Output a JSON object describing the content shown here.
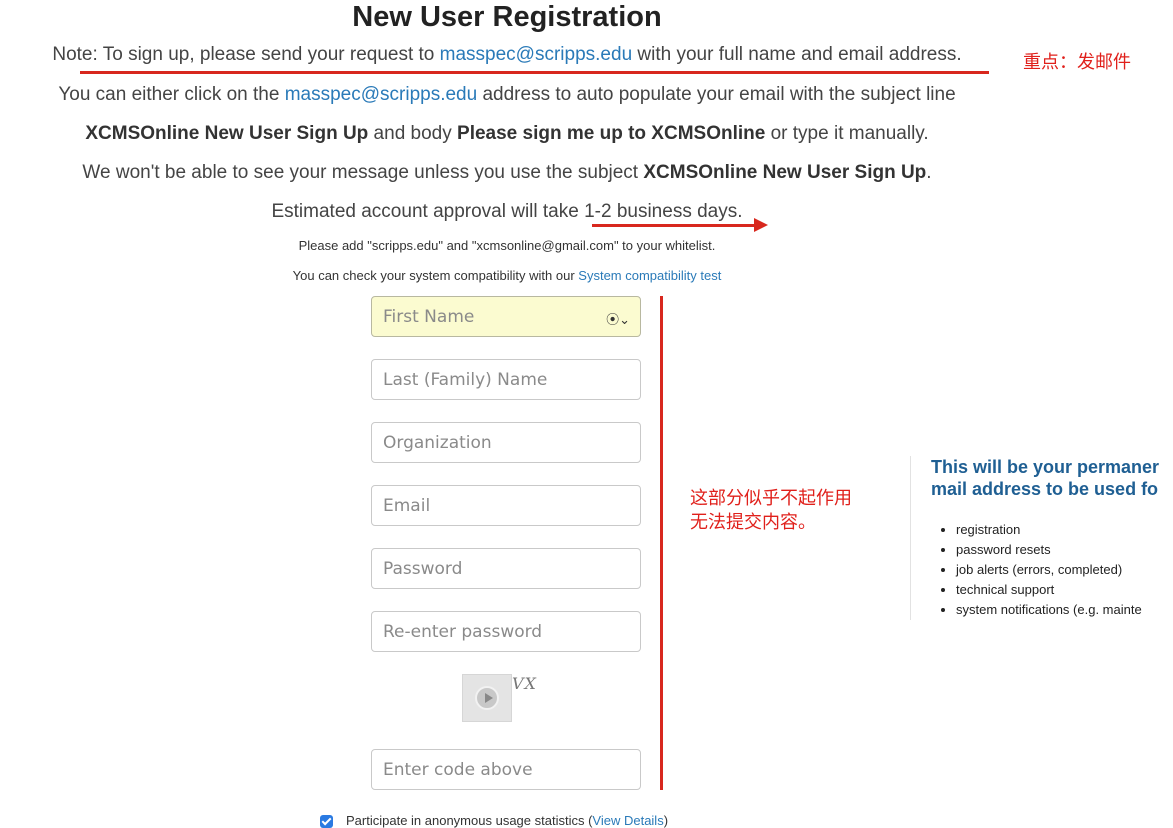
{
  "page": {
    "title": "New User Registration"
  },
  "note": {
    "prefix": "Note: ",
    "text1": "To sign up, please send your request to ",
    "email": "masspec@scripps.edu",
    "text2": " with your full name and email address."
  },
  "line2": {
    "text1": "You can either click on the ",
    "email": "masspec@scripps.edu",
    "text2": " address to auto populate your email with the subject line"
  },
  "line3": {
    "bold1": "XCMSOnline New User Sign Up",
    "text1": " and body ",
    "bold2": "Please sign me up to XCMSOnline",
    "text2": " or type it manually."
  },
  "line4": {
    "text1": "We won't be able to see your message unless you use the subject ",
    "bold1": "XCMSOnline New User Sign Up",
    "text2": "."
  },
  "line5": {
    "text": "Estimated account approval will take 1-2 business days."
  },
  "whitelist": {
    "text": "Please add \"scripps.edu\" and \"xcmsonline@gmail.com\" to your whitelist."
  },
  "compat": {
    "text": "You can check your system compatibility with our ",
    "link": "System compatibility test"
  },
  "form": {
    "first_name_placeholder": "First Name",
    "last_name_placeholder": "Last (Family) Name",
    "organization_placeholder": "Organization",
    "email_placeholder": "Email",
    "password_placeholder": "Password",
    "reenter_password_placeholder": "Re-enter password",
    "captcha_code_placeholder": "Enter code above",
    "captcha_text": "VX",
    "autofill_icon": "user-circle-icon"
  },
  "checkbox": {
    "label_text": "Participate in anonymous usage statistics (",
    "link": "View Details",
    "label_end": ")",
    "checked": true
  },
  "info": {
    "title_line1": "This will be your permaner",
    "title_line2": "mail address to be used fo",
    "items": [
      "registration",
      "password resets",
      "job alerts (errors, completed)",
      "technical support",
      "system notifications (e.g. mainte"
    ]
  },
  "annotations": {
    "key_point": "重点：发邮件",
    "form_note_line1": "这部分似乎不起作用",
    "form_note_line2": "无法提交内容。"
  },
  "colors": {
    "link": "#2a7ab8",
    "annotation_red": "#e0201b",
    "info_title": "#1f5f93",
    "autofill_bg": "#fbfbd0"
  }
}
